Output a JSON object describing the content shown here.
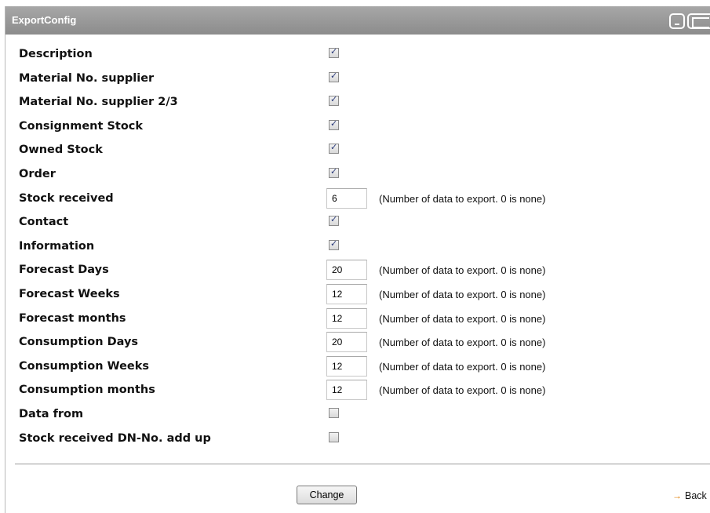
{
  "window": {
    "title": "ExportConfig"
  },
  "hint_text": "(Number of data to export. 0 is none)",
  "rows": [
    {
      "label": "Description",
      "type": "checkbox",
      "checked": true
    },
    {
      "label": "Material No. supplier",
      "type": "checkbox",
      "checked": true
    },
    {
      "label": "Material No. supplier 2/3",
      "type": "checkbox",
      "checked": true
    },
    {
      "label": "Consignment Stock",
      "type": "checkbox",
      "checked": true
    },
    {
      "label": "Owned Stock",
      "type": "checkbox",
      "checked": true
    },
    {
      "label": "Order",
      "type": "checkbox",
      "checked": true
    },
    {
      "label": "Stock received",
      "type": "number",
      "value": "6"
    },
    {
      "label": "Contact",
      "type": "checkbox",
      "checked": true
    },
    {
      "label": "Information",
      "type": "checkbox",
      "checked": true
    },
    {
      "label": "Forecast Days",
      "type": "number",
      "value": "20"
    },
    {
      "label": "Forecast Weeks",
      "type": "number",
      "value": "12"
    },
    {
      "label": "Forecast months",
      "type": "number",
      "value": "12"
    },
    {
      "label": "Consumption Days",
      "type": "number",
      "value": "20"
    },
    {
      "label": "Consumption Weeks",
      "type": "number",
      "value": "12"
    },
    {
      "label": "Consumption months",
      "type": "number",
      "value": "12"
    },
    {
      "label": "Data from",
      "type": "checkbox",
      "checked": false
    },
    {
      "label": "Stock received DN-No. add up",
      "type": "checkbox",
      "checked": false
    }
  ],
  "footer": {
    "change_label": "Change",
    "back_label": "Back",
    "back_icon": "arrow-right-icon",
    "accent_color": "#e07b00"
  }
}
